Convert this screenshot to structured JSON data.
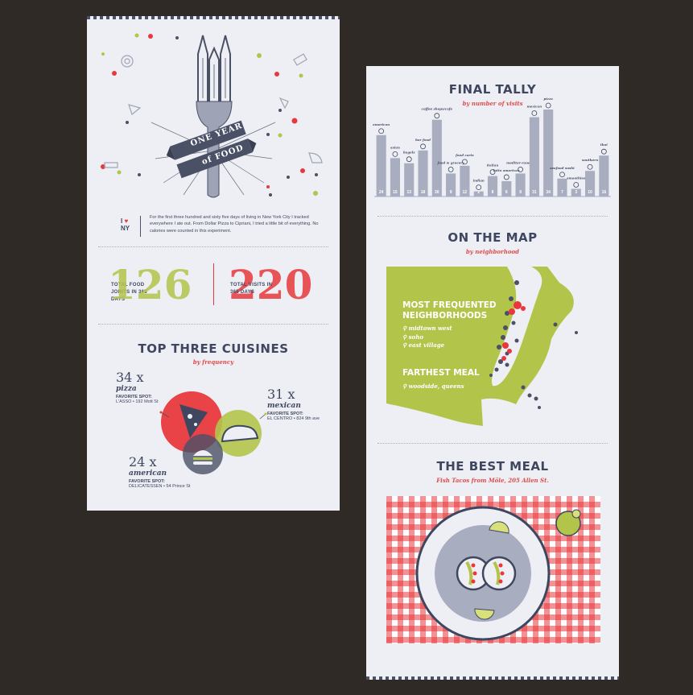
{
  "left": {
    "banner_line1": "ONE YEAR",
    "banner_line2": "of FOOD",
    "ilny": "I",
    "ilny_ny": "NY",
    "intro": "For the first three hundred and sixty five days of living in New York City I tracked everywhere I ate out. From Dollar Pizza to Cipriani, I tried a little bit of everything. No calories were counted in this experiment.",
    "stat1_label": "TOTAL FOOD JOINTS IN 365 DAYS",
    "stat1_value": "126",
    "stat2_label": "TOTAL VISITS IN 365 DAYS",
    "stat2_value": "220",
    "cuisines_title": "TOP THREE CUISINES",
    "cuisines_sub": "by frequency",
    "cuisines": [
      {
        "count": "34 x",
        "name": "pizza",
        "spot_label": "FAVORITE SPOT:",
        "spot": "L'ASSO • 192 Mott St",
        "color": "#e8383d"
      },
      {
        "count": "31 x",
        "name": "mexican",
        "spot_label": "FAVORITE SPOT:",
        "spot": "EL CENTRO • 824 9th ave",
        "color": "#b3c44a"
      },
      {
        "count": "24 x",
        "name": "american",
        "spot_label": "FAVORITE SPOT:",
        "spot": "DELICATESSEN • 54 Prince St",
        "color": "#4a5066"
      }
    ]
  },
  "right": {
    "tally_title": "FINAL TALLY",
    "tally_sub": "by number of visits",
    "map_title": "ON THE MAP",
    "map_sub": "by neighborhood",
    "map_head1": "MOST FREQUENTED NEIGHBORHOODS",
    "neighborhoods": [
      "midtown west",
      "soho",
      "east village"
    ],
    "map_head2": "FARTHEST MEAL",
    "farthest": "woodside, queens",
    "meal_title": "THE BEST MEAL",
    "meal_sub": "Fish Tacos from Möle, 205 Allen St."
  },
  "chart_data": {
    "type": "bar",
    "title": "FINAL TALLY",
    "subtitle": "by number of visits",
    "categories": [
      "american",
      "asian",
      "bagels",
      "bar food",
      "coffee shops/cafe",
      "food & grocery",
      "food carts",
      "indian",
      "italian",
      "latin american",
      "mediter-ranean",
      "mexican",
      "pizza",
      "seafood sushi",
      "smoothies",
      "southern",
      "thai"
    ],
    "values": [
      24,
      15,
      13,
      18,
      30,
      9,
      12,
      2,
      8,
      6,
      9,
      31,
      34,
      7,
      3,
      10,
      16
    ]
  },
  "colors": {
    "red": "#e8383d",
    "green": "#b3c44a",
    "navy": "#4a5066",
    "bar": "#a8adbf",
    "bg": "#eeeff4"
  }
}
